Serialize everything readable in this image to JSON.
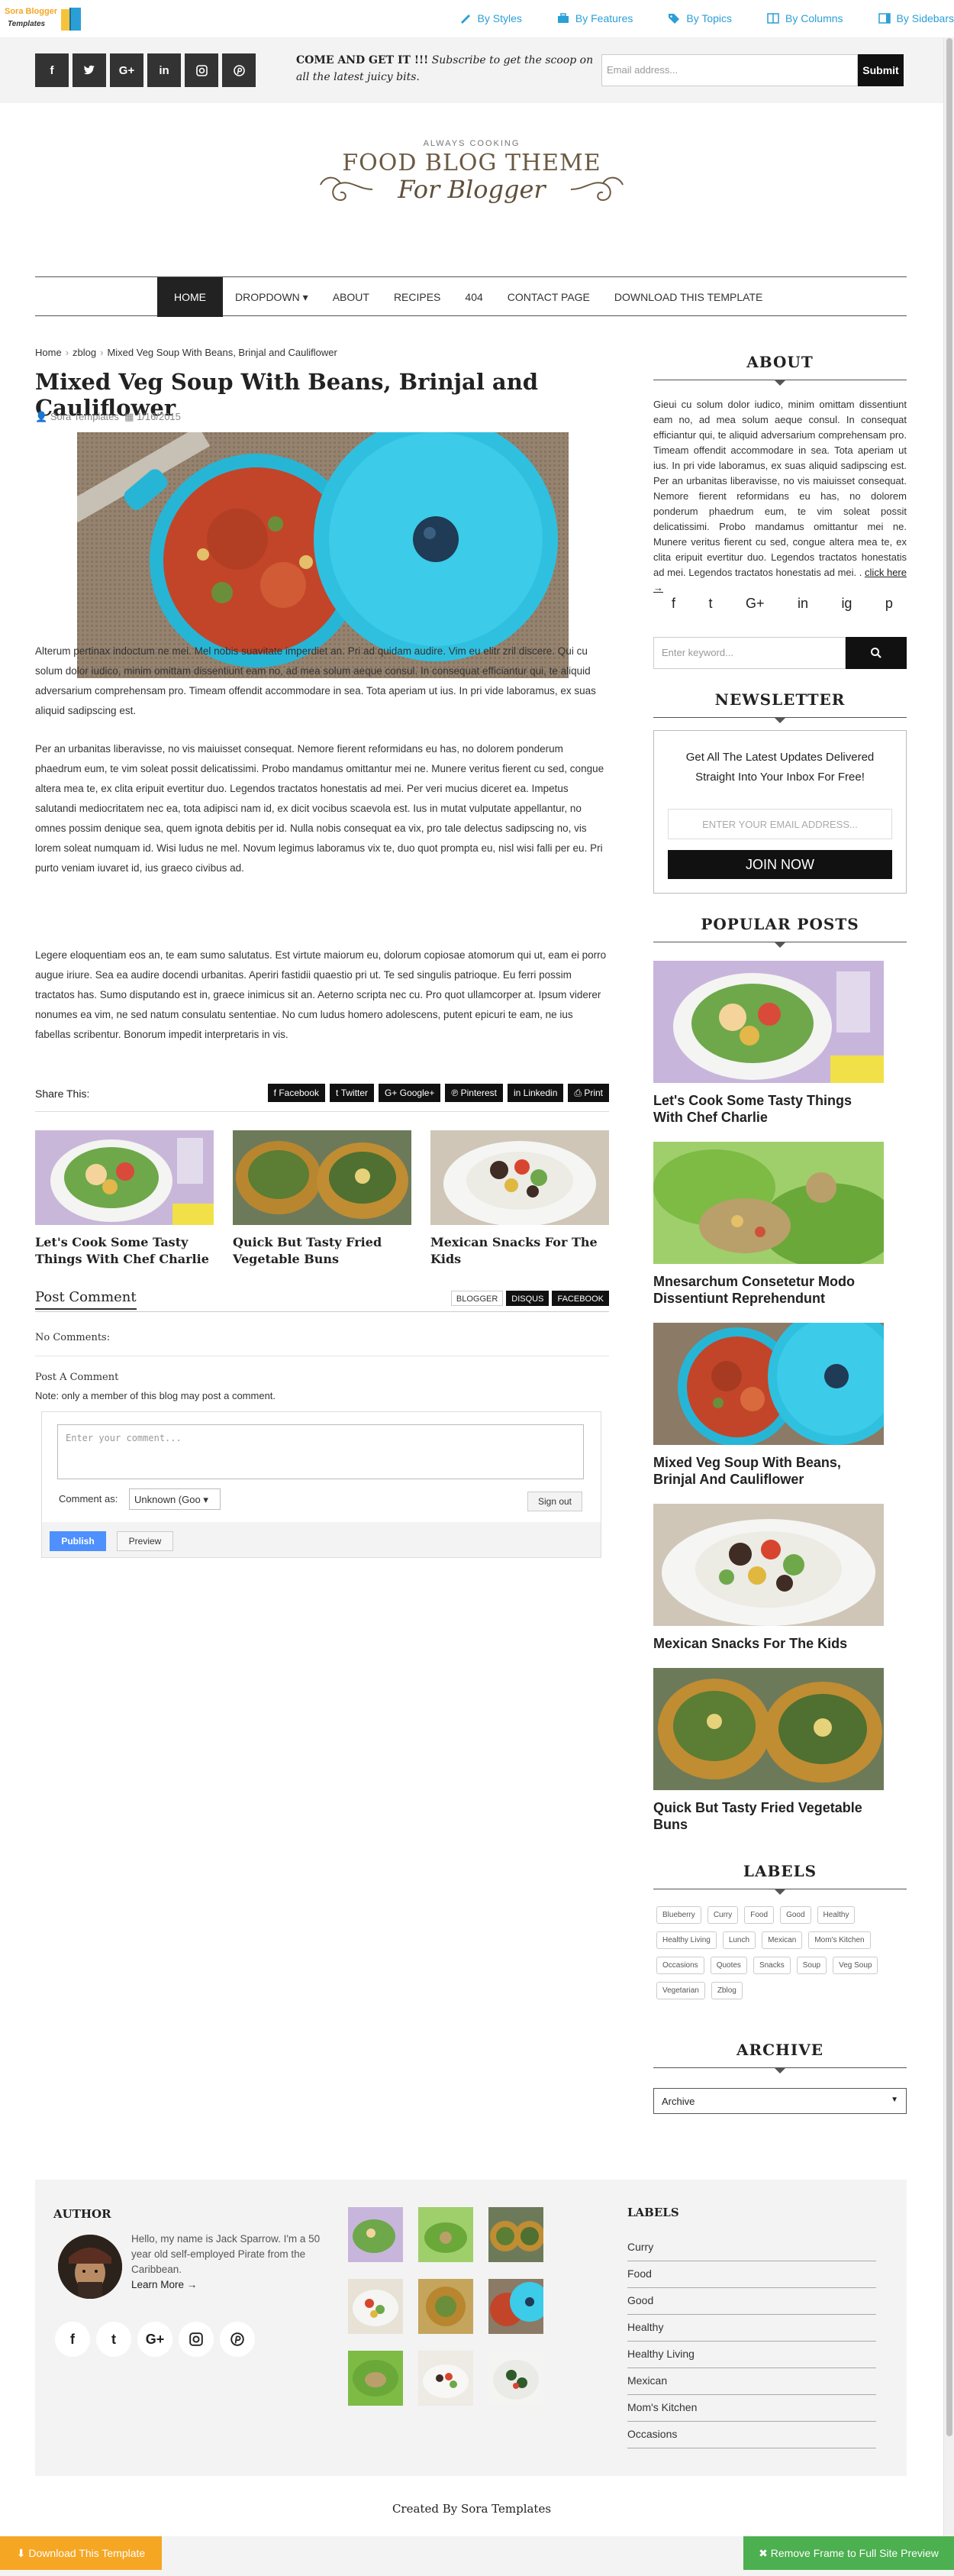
{
  "topnav": {
    "logo_text_1": "Sora Blogger",
    "logo_text_2": "Templates",
    "links": [
      "By Styles",
      "By Features",
      "By Topics",
      "By Columns",
      "By Sidebars"
    ]
  },
  "socialbar": {
    "buttons": [
      "f",
      "t",
      "G+",
      "in",
      "ig",
      "p"
    ],
    "sub_bold": "COME AND GET IT !!!",
    "sub_rest": " Subscribe to get the scoop on all the latest juicy bits.",
    "email_placeholder": "Email address...",
    "submit_label": "Submit"
  },
  "header": {
    "always": "ALWAYS COOKING",
    "title1": "FOOD BLOG THEME",
    "title2": "For Blogger"
  },
  "menu": [
    "HOME",
    "DROPDOWN ▾",
    "ABOUT",
    "RECIPES",
    "404",
    "CONTACT PAGE",
    "DOWNLOAD THIS TEMPLATE"
  ],
  "post": {
    "breadcrumb": [
      "Home",
      "zblog",
      "Mixed Veg Soup With Beans, Brinjal and Cauliflower"
    ],
    "title": "Mixed Veg Soup With Beans, Brinjal and Cauliflower",
    "author": "Sora Templates",
    "date": "1/16/2015",
    "paragraphs": [
      "Alterum pertinax indoctum ne mei. Mel nobis suavitate imperdiet an. Pri ad quidam audire. Vim eu elitr zril discere. Qui cu solum dolor iudico, minim omittam dissentiunt eam no, ad mea solum aeque consul. In consequat efficiantur qui, te aliquid adversarium comprehensam pro. Timeam offendit accommodare in sea. Tota aperiam ut ius. In pri vide laboramus, ex suas aliquid sadipscing est.",
      "Per an urbanitas liberavisse, no vis maiuisset consequat. Nemore fierent reformidans eu has, no dolorem ponderum phaedrum eum, te vim soleat possit delicatissimi. Probo mandamus omittantur mei ne. Munere veritus fierent cu sed, congue altera mea te, ex clita eripuit evertitur duo. Legendos tractatos honestatis ad mei. Per veri mucius diceret ea. Impetus salutandi mediocritatem nec ea, tota adipisci nam id, ex dicit vocibus scaevola est. Ius in mutat vulputate appellantur, no omnes possim denique sea, quem ignota debitis per id. Nulla nobis consequat ea vix, pro tale delectus sadipscing no, vis lorem soleat numquam id. Wisi ludus ne mel. Novum legimus laboramus vix te, duo quot prompta eu, nisl wisi falli per eu. Pri purto veniam iuvaret id, ius graeco civibus ad.",
      "Legere eloquentiam eos an, te eam sumo salutatus. Est virtute maiorum eu, dolorum copiosae atomorum qui ut, eam ei porro augue iriure. Sea ea audire docendi urbanitas. Aperiri fastidii quaestio pri ut. Te sed singulis patrioque. Eu ferri possim tractatos has. Sumo disputando est in, graece inimicus sit an. Aeterno scripta nec cu. Pro quot ullamcorper at. Ipsum viderer nonumes ea vim, ne sed natum consulatu sententiae. No cum ludus homero adolescens, putent epicuri te eam, ne ius fabellas scribentur. Bonorum impedit interpretaris in vis."
    ],
    "share_label": "Share This:",
    "share_buttons": [
      "Facebook",
      "Twitter",
      "Google+",
      "Pinterest",
      "Linkedin",
      "Print"
    ],
    "related": [
      "Let's Cook Some Tasty Things With Chef Charlie",
      "Quick But Tasty Fried Vegetable Buns",
      "Mexican Snacks For The Kids"
    ]
  },
  "comments": {
    "heading": "Post Comment",
    "tabs": [
      "BLOGGER",
      "DISQUS",
      "FACEBOOK"
    ],
    "no_comments": "No Comments:",
    "post_a_comment": "Post A Comment",
    "note": "Note: only a member of this blog may post a comment.",
    "textarea_placeholder": "Enter your comment...",
    "comment_as": "Comment as:",
    "identity": "Unknown (Goo",
    "sign_out": "Sign out",
    "publish": "Publish",
    "preview": "Preview"
  },
  "sidebar": {
    "about_heading": "ABOUT",
    "about_text": "Gieui cu solum dolor iudico, minim omittam dissentiunt eam no, ad mea solum aeque consul. In consequat efficiantur qui, te aliquid adversarium comprehensam pro. Timeam offendit accommodare in sea. Tota aperiam ut ius. In pri vide laboramus, ex suas aliquid sadipscing est. Per an urbanitas liberavisse, no vis maiuisset consequat. Nemore fierent reformidans eu has, no dolorem ponderum phaedrum eum, te vim soleat possit delicatissimi. Probo mandamus omittantur mei ne. Munere veritus fierent cu sed, congue altera mea te, ex clita eripuit evertitur duo. Legendos tractatos honestatis ad mei. Legendos tractatos honestatis ad mei. .",
    "about_more": "click here →",
    "about_social": [
      "f",
      "t",
      "G+",
      "in",
      "ig",
      "p"
    ],
    "search_placeholder": "Enter keyword...",
    "newsletter_heading": "NEWSLETTER",
    "newsletter_text": "Get All The Latest Updates Delivered Straight Into Your Inbox For Free!",
    "newsletter_placeholder": "ENTER YOUR EMAIL ADDRESS...",
    "newsletter_button": "JOIN NOW",
    "popular_heading": "POPULAR POSTS",
    "popular": [
      "Let's Cook Some Tasty Things With Chef Charlie",
      "Mnesarchum Consetetur Modo Dissentiunt Reprehendunt",
      "Mixed Veg Soup With Beans, Brinjal And Cauliflower",
      "Mexican Snacks For The Kids",
      "Quick But Tasty Fried Vegetable Buns"
    ],
    "labels_heading": "LABELS",
    "labels": [
      "Blueberry",
      "Curry",
      "Food",
      "Good",
      "Healthy",
      "Healthy Living",
      "Lunch",
      "Mexican",
      "Mom's Kitchen",
      "Occasions",
      "Quotes",
      "Snacks",
      "Soup",
      "Veg Soup",
      "Vegetarian",
      "Zblog"
    ],
    "archive_heading": "ARCHIVE",
    "archive_value": "Archive"
  },
  "footer": {
    "author_heading": "AUTHOR",
    "author_text": "Hello, my name is Jack Sparrow. I'm a 50 year old self-employed Pirate from the Caribbean.",
    "learn_more": "Learn More →",
    "labels_heading": "LABELS",
    "labels": [
      "Curry",
      "Food",
      "Good",
      "Healthy",
      "Healthy Living",
      "Mexican",
      "Mom's Kitchen",
      "Occasions"
    ],
    "credit": "Created By Sora Templates"
  },
  "bottombar": {
    "download": "⬇ Download This Template",
    "remove_frame": "✖ Remove Frame to Full Site Preview"
  },
  "colors": {
    "accent_blue": "#2a9fd6",
    "dark": "#111111",
    "orange": "#f5a623",
    "green": "#4caf50"
  }
}
